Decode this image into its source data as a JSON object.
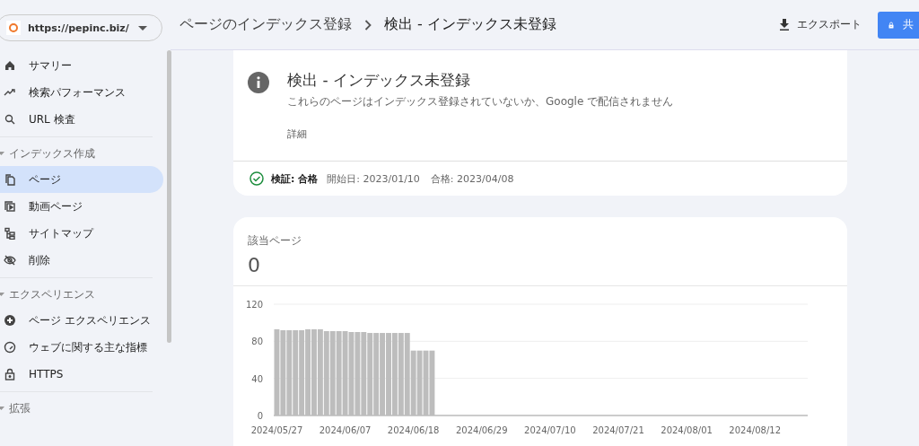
{
  "property_selector": {
    "url": "https://pepinc.biz/"
  },
  "sidebar": {
    "sections": [
      {
        "items": [
          {
            "label": "サマリー",
            "selected": false
          },
          {
            "label": "検索パフォーマンス",
            "selected": false
          },
          {
            "label": "URL 検査",
            "selected": false
          }
        ]
      },
      {
        "heading": "インデックス作成",
        "items": [
          {
            "label": "ページ",
            "selected": true
          },
          {
            "label": "動画ページ",
            "selected": false
          },
          {
            "label": "サイトマップ",
            "selected": false
          },
          {
            "label": "削除",
            "selected": false
          }
        ]
      },
      {
        "heading": "エクスペリエンス",
        "items": [
          {
            "label": "ページ エクスペリエンス",
            "selected": false
          },
          {
            "label": "ウェブに関する主な指標",
            "selected": false
          },
          {
            "label": "HTTPS",
            "selected": false
          }
        ]
      },
      {
        "heading": "拡張"
      }
    ]
  },
  "breadcrumb": [
    "ページのインデックス登録",
    "検出 - インデックス未登録"
  ],
  "actions": {
    "export": "エクスポート",
    "share": "共"
  },
  "issue_card": {
    "title": "検出 - インデックス未登録",
    "description": "これらのページはインデックス登録されていないか、Google で配信されません",
    "details": "詳細",
    "validation": {
      "label": "検証: 合格",
      "started": "開始日: 2023/01/10",
      "passed": "合格: 2023/04/08"
    }
  },
  "pages_card": {
    "label": "該当ページ",
    "count": "0",
    "chart_data": {
      "type": "bar",
      "categories": [
        "2024/05/27",
        null,
        null,
        null,
        null,
        null,
        null,
        null,
        null,
        null,
        null,
        "2024/06/07",
        null,
        null,
        null,
        null,
        null,
        null,
        null,
        null,
        null,
        null,
        "2024/06/18",
        null,
        null,
        null,
        null,
        null,
        null,
        null,
        null,
        null,
        null,
        "2024/06/29",
        null,
        null,
        null,
        null,
        null,
        null,
        null,
        null,
        null,
        null,
        "2024/07/10",
        null,
        null,
        null,
        null,
        null,
        null,
        null,
        null,
        null,
        null,
        "2024/07/21",
        null,
        null,
        null,
        null,
        null,
        null,
        null,
        null,
        null,
        null,
        "2024/08/01",
        null,
        null,
        null,
        null,
        null,
        null,
        null,
        null,
        null,
        null,
        "2024/08/12",
        null,
        null,
        null,
        null,
        null,
        null,
        null,
        null
      ],
      "series": [
        {
          "color": "#bdbdbd",
          "values": [
            93,
            92,
            92,
            92,
            92,
            93,
            93,
            93,
            91,
            91,
            91,
            91,
            90,
            90,
            90,
            89,
            89,
            89,
            89,
            89,
            89,
            89,
            70,
            70,
            70,
            70,
            null,
            null,
            null,
            null,
            null,
            null,
            null,
            null,
            null,
            null,
            null,
            null,
            null,
            null,
            null,
            null,
            null,
            null,
            null,
            null,
            null,
            null,
            null,
            null,
            null,
            null,
            null,
            null,
            null,
            null,
            null,
            null,
            null,
            null,
            null,
            null,
            null,
            null,
            null,
            null,
            null,
            null,
            null,
            null,
            null,
            null,
            null,
            null,
            null,
            null,
            null,
            null,
            null,
            null,
            null,
            null,
            null,
            null,
            null,
            null
          ]
        }
      ],
      "ylim": [
        0,
        120
      ],
      "yticks": [
        0,
        40,
        80,
        120
      ]
    }
  }
}
